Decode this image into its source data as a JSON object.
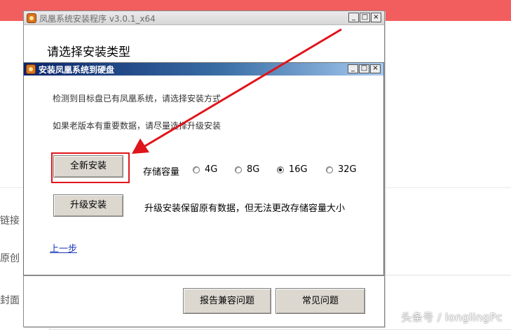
{
  "background": {
    "labels": [
      "链接",
      "原创",
      "封面"
    ]
  },
  "outer_window": {
    "title": "凤凰系统安装程序 v3.0.1_x64",
    "heading": "请选择安装类型",
    "controls": {
      "minimize": "_",
      "maximize": "□",
      "close": "×"
    },
    "footer": {
      "compat_button": "报告兼容问题",
      "faq_button": "常见问题"
    }
  },
  "inner_dialog": {
    "title": "安装凤凰系统到硬盘",
    "controls": {
      "minimize": "_",
      "maximize": "□",
      "close": "×"
    },
    "info_line_1": "检测到目标盘已有凤凰系统，请选择安装方式",
    "info_line_2": "如果老版本有重要数据，请尽量选择升级安装",
    "fresh_install_button": "全新安装",
    "storage_label": "存储容量",
    "storage_options": [
      {
        "label": "4G",
        "checked": false
      },
      {
        "label": "8G",
        "checked": false
      },
      {
        "label": "16G",
        "checked": true
      },
      {
        "label": "32G",
        "checked": false
      }
    ],
    "upgrade_button": "升级安装",
    "upgrade_note": "升级安装保留原有数据，但无法更改存储容量大小",
    "back_link": "上一步"
  },
  "watermark": "头条号 / longlingPc",
  "colors": {
    "banner": "#f25e5e",
    "highlight": "#e0141b",
    "arrow": "#e0141b",
    "title_gradient_start": "#0a246a",
    "title_gradient_end": "#a6caf0",
    "link": "#1a35b8"
  },
  "icons": [
    "app-icon",
    "red-arrow-annotation",
    "radio-icon"
  ]
}
